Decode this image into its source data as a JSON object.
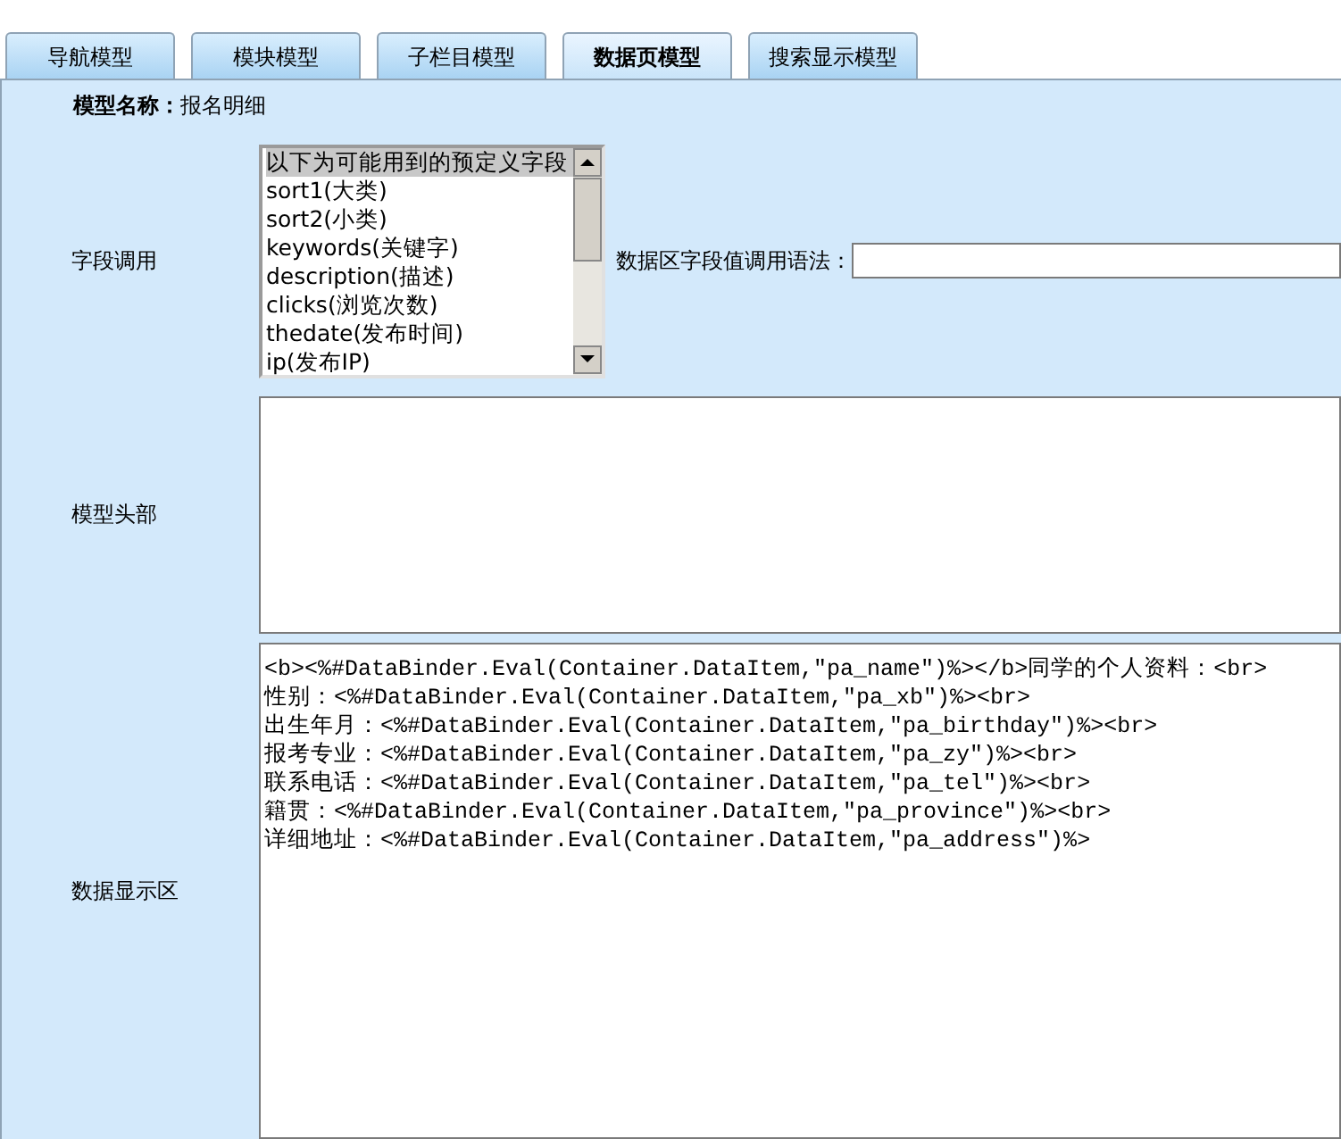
{
  "tabs": [
    {
      "label": "导航模型",
      "selected": false
    },
    {
      "label": "模块模型",
      "selected": false
    },
    {
      "label": "子栏目模型",
      "selected": false
    },
    {
      "label": "数据页模型",
      "selected": true
    },
    {
      "label": "搜索显示模型",
      "selected": false
    }
  ],
  "model_name": {
    "label": "模型名称：",
    "value": "报名明细"
  },
  "field_call": {
    "label": "字段调用",
    "options": [
      {
        "text": "以下为可能用到的预定义字段",
        "selected": true
      },
      {
        "text": "sort1(大类)",
        "selected": false
      },
      {
        "text": "sort2(小类)",
        "selected": false
      },
      {
        "text": "keywords(关键字)",
        "selected": false
      },
      {
        "text": "description(描述)",
        "selected": false
      },
      {
        "text": "clicks(浏览次数)",
        "selected": false
      },
      {
        "text": "thedate(发布时间)",
        "selected": false
      },
      {
        "text": "ip(发布IP)",
        "selected": false
      }
    ],
    "syntax_label": "数据区字段值调用语法："
  },
  "model_header": {
    "label": "模型头部"
  },
  "data_area": {
    "label": "数据显示区",
    "lines": [
      "<b><%#DataBinder.Eval(Container.DataItem,\"pa_name\")%></b>同学的个人资料：<br>",
      "性别：<%#DataBinder.Eval(Container.DataItem,\"pa_xb\")%><br>",
      "出生年月：<%#DataBinder.Eval(Container.DataItem,\"pa_birthday\")%><br>",
      "报考专业：<%#DataBinder.Eval(Container.DataItem,\"pa_zy\")%><br>",
      "联系电话：<%#DataBinder.Eval(Container.DataItem,\"pa_tel\")%><br>",
      "籍贯：<%#DataBinder.Eval(Container.DataItem,\"pa_province\")%><br>",
      "详细地址：<%#DataBinder.Eval(Container.DataItem,\"pa_address\")%>"
    ]
  }
}
